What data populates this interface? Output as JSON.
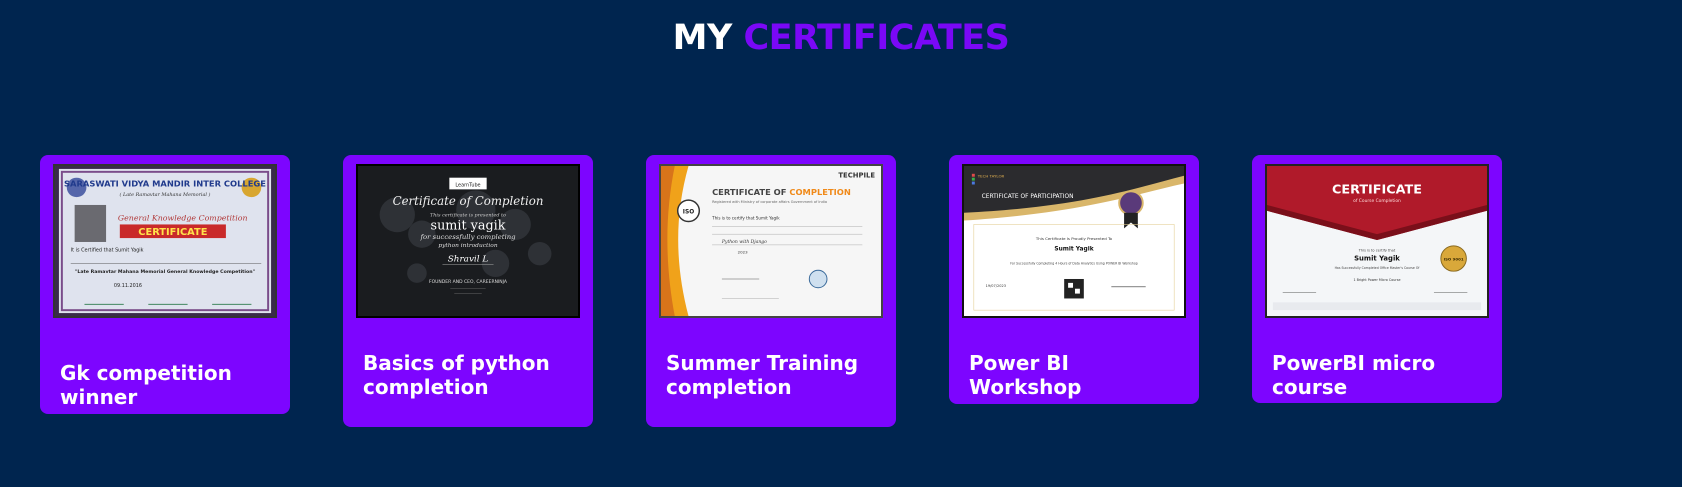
{
  "section": {
    "title_part1": "MY",
    "title_part2": "CERTIFICATES"
  },
  "cards": [
    {
      "label": "Gk competition winner",
      "cert": {
        "school": "SARASWATI VIDYA MANDIR INTER COLLEGE",
        "memorial": "( Late Ramavtar Mahana Memorial )",
        "competition": "General Knowledge Competition",
        "heading": "CERTIFICATE",
        "name_line": "It is Certified that  Sumit Yagik",
        "event": "\"Late Ramavtar Mahana Memorial General Knowledge Competition\"",
        "date": "09.11.2016"
      }
    },
    {
      "label": "Basics of python completion",
      "cert": {
        "brand": "LearnTube",
        "heading": "Certificate of Completion",
        "intro": "This certificate is presented to",
        "name": "sumit yagik",
        "for_line": "for successfully completing",
        "course": "python introduction",
        "signer": "Shravil L",
        "org": "FOUNDER AND CEO, CAREERNINJA"
      }
    },
    {
      "label": "Summer Training completion",
      "cert": {
        "brand": "TECHPILE",
        "heading_part1": "CERTIFICATE OF",
        "heading_part2": "COMPLETION",
        "registered": "Registered with Ministry of corporate affairs Government of India",
        "name_line": "This is to certify that  Sumit  Yagik",
        "course": "Python with Django",
        "year": "2023",
        "badge": "ISO"
      }
    },
    {
      "label": "Power BI Workshop",
      "cert": {
        "brand": "TECH TAYLOR",
        "heading": "CERTIFICATE OF PARTICIPATION",
        "proud": "This Certificate Is Proudly Presented To",
        "name": "Sumit Yagik",
        "desc": "For Successfully Completing 4 Hours of Data Analytics Using POWER BI Workshop",
        "date": "19/07/2023"
      }
    },
    {
      "label": "PowerBI micro course",
      "cert": {
        "heading": "CERTIFICATE",
        "sub": "of Course Completion",
        "presented": "This is to certify that",
        "name": "Sumit Yagik",
        "desc": "Has Successfully Completed Office Master's Course Of",
        "course": "1 Bright Power Micro Course",
        "seal": "ISO 9001"
      }
    }
  ],
  "colors": {
    "background": "#00254f",
    "accent": "#7d05ff",
    "title_accent": "#7a08f7"
  }
}
